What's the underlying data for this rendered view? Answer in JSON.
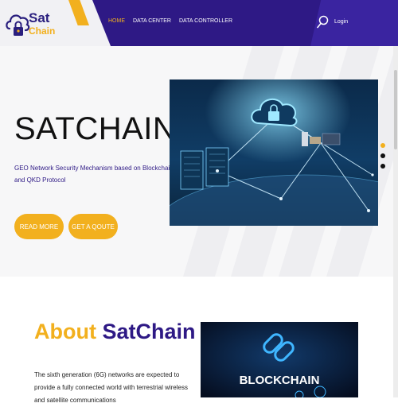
{
  "header": {
    "logo_sat": "Sat",
    "logo_chain": "Chain",
    "nav": [
      "HOME",
      "DATA CENTER",
      "DATA CONTROLLER"
    ],
    "active_nav": "HOME",
    "login": "Login",
    "search_icon": "search-icon"
  },
  "hero": {
    "title": "SATCHAIN",
    "subtitle": "GEO Network Security Mechanism based on Blockchain and QKD Protocol",
    "read_more": "READ MORE",
    "quote": "GET A QOUTE"
  },
  "about": {
    "title_yellow": "About",
    "title_purple": "SatChain",
    "text": "The sixth generation (6G) networks are expected to provide a fully connected world with terrestrial wireless and satellite communications",
    "image_label": "BLOCKCHAIN"
  },
  "colors": {
    "brand_purple": "#2e1985",
    "accent_yellow": "#f2b01e",
    "dot_active": "#f2b01e",
    "dot_inactive": "#111111"
  }
}
